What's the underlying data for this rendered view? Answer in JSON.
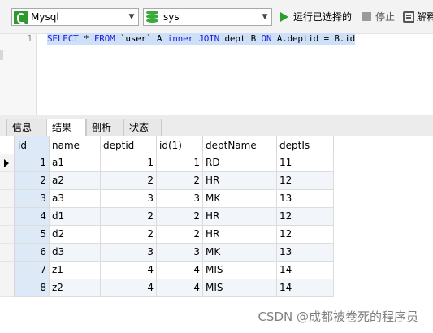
{
  "toolbar": {
    "connection": "Mysql",
    "database": "sys",
    "run_label": "运行已选择的",
    "stop_label": "停止",
    "explain_label": "解释"
  },
  "editor": {
    "line_number": "1",
    "sql_tokens": [
      {
        "t": "SELECT",
        "kw": true
      },
      {
        "t": " * ",
        "kw": false
      },
      {
        "t": "FROM",
        "kw": true
      },
      {
        "t": " `user` A ",
        "kw": false
      },
      {
        "t": "inner",
        "kw": true
      },
      {
        "t": " ",
        "kw": false
      },
      {
        "t": "JOIN",
        "kw": true
      },
      {
        "t": " dept B ",
        "kw": false
      },
      {
        "t": "ON",
        "kw": true
      },
      {
        "t": " A.deptid = B.id",
        "kw": false
      }
    ]
  },
  "tabs": [
    "信息",
    "结果 1",
    "剖析",
    "状态"
  ],
  "active_tab": 1,
  "grid": {
    "columns": [
      "id",
      "name",
      "deptid",
      "id(1)",
      "deptName",
      "deptIs"
    ],
    "numeric": [
      true,
      false,
      true,
      true,
      false,
      false
    ],
    "rows": [
      [
        "1",
        "a1",
        "1",
        "1",
        "RD",
        "11"
      ],
      [
        "2",
        "a2",
        "2",
        "2",
        "HR",
        "12"
      ],
      [
        "3",
        "a3",
        "3",
        "3",
        "MK",
        "13"
      ],
      [
        "4",
        "d1",
        "2",
        "2",
        "HR",
        "12"
      ],
      [
        "5",
        "d2",
        "2",
        "2",
        "HR",
        "12"
      ],
      [
        "6",
        "d3",
        "3",
        "3",
        "MK",
        "13"
      ],
      [
        "7",
        "z1",
        "4",
        "4",
        "MIS",
        "14"
      ],
      [
        "8",
        "z2",
        "4",
        "4",
        "MIS",
        "14"
      ]
    ]
  },
  "watermark": "CSDN @成都被卷死的程序员"
}
